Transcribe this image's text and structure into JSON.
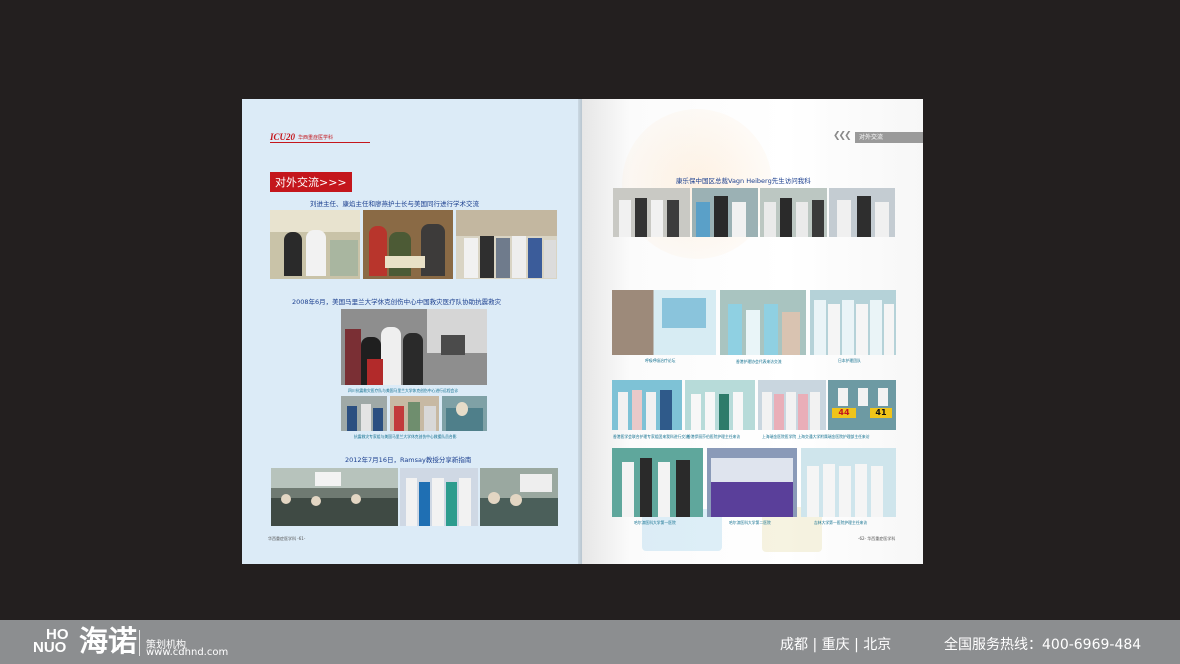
{
  "left_page": {
    "brand_logo": "ICU20",
    "brand_dept": "华西重症医学科",
    "section_title": "对外交流>>>",
    "caption_1": "刘进主任、康焰主任和廖燕护士长与美国同行进行学术交流",
    "caption_2": "2008年6月，美国马里兰大学休克创伤中心中国救灾医疗队协助抗震救灾",
    "small_caption_1": "四川抗震救灾医疗队与美国马里兰大学休克创伤中心进行远程会诊",
    "small_caption_2": "抗震救灾专家组与美国马里兰大学休克创伤中心救援队员合影",
    "caption_3": "2012年7月16日，Ramsay教授分享新指南",
    "folio_text": "华西重症医学科",
    "folio_number": "61"
  },
  "right_page": {
    "tab_label": "对外交流",
    "headline": "康乐保中国区总裁Vagn Heiberg先生访问我科",
    "row2_captions": [
      "呼吸呼吸治疗论坛",
      "香港护理协会代表来访交流",
      "日本护理团队"
    ],
    "row3_captions": [
      "香港医学会联合护理专家组团来我科进行交流",
      "香港伊丽莎伯医院护理主任来访",
      "上海瑞金医院医学院 上海交通大学附属瑞金医院护理部主任来访"
    ],
    "row4_captions": [
      "哈尔滨医科大学第一医院",
      "哈尔滨医科大学第二医院",
      "吉林大学第一医院护理主任来访"
    ],
    "folio_text": "华西重症医学科",
    "folio_number": "62"
  },
  "footer": {
    "logo_ho": "HO",
    "logo_nuo": "NUO",
    "logo_cn": "海诺",
    "plan_text": "策划机构",
    "url": "www.cdhnd.com",
    "cities": "成都 | 重庆 | 北京",
    "hotline": "全国服务热线：400-6969-484"
  },
  "colors": {
    "accent_red": "#c4161c",
    "caption_blue": "#1b3f8f",
    "left_page_bg": "#dcebf7",
    "frame_bg": "#231f1f",
    "footer_bg": "#8c8e90"
  }
}
